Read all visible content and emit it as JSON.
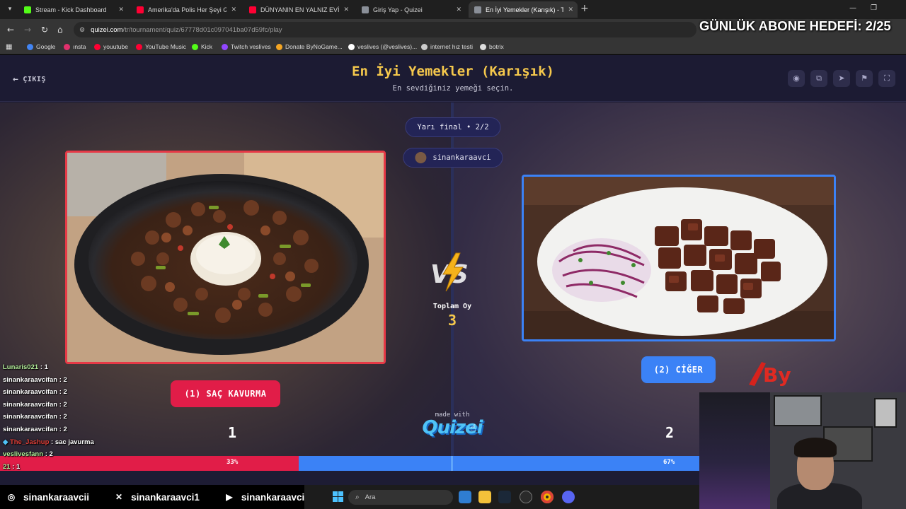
{
  "browser": {
    "tabs": [
      {
        "title": "Stream - Kick Dashboard",
        "color": "#53fc18"
      },
      {
        "title": "Amerika'da Polis Her Şeyi Görüy",
        "color": "#ff0033"
      },
      {
        "title": "DÜNYANIN EN YALNIZ EVİNDE",
        "color": "#ff0033"
      },
      {
        "title": "Giriş Yap - Quizei",
        "color": "#8a8f98"
      },
      {
        "title": "En İyi Yemekler (Karışık) - Tier L",
        "color": "#8a8f98"
      }
    ],
    "url_host": "quizei.com",
    "url_path": "/tr/tournament/quiz/67778d01c097041ba07d59fc/play",
    "bookmarks": [
      {
        "label": "Google",
        "color": "#4285f4"
      },
      {
        "label": "ınsta",
        "color": "#e1306c"
      },
      {
        "label": "youutube",
        "color": "#ff0033"
      },
      {
        "label": "YouTube Music",
        "color": "#ff0033"
      },
      {
        "label": "Kick",
        "color": "#53fc18"
      },
      {
        "label": "Twitch veslives",
        "color": "#9146ff"
      },
      {
        "label": "Donate ByNoGame...",
        "color": "#f5a623"
      },
      {
        "label": "veslives (@veslives)...",
        "color": "#ffffff"
      },
      {
        "label": "internet hız testi",
        "color": "#cccccc"
      },
      {
        "label": "botrix",
        "color": "#dddddd"
      }
    ]
  },
  "stream_overlay": {
    "goal_text": "GÜNLÜK ABONE HEDEFİ: 2/25"
  },
  "quiz": {
    "exit_label": "ÇIKIŞ",
    "title": "En İyi Yemekler (Karışık)",
    "subtitle": "En sevdiğiniz yemeği seçin.",
    "round_label": "Yarı final • 2/2",
    "creator": "sinankaraavci",
    "total_label": "Toplam Oy",
    "total_votes": "3",
    "made_with": "made with",
    "brand": "Quizei",
    "left": {
      "label": "(1) SAÇ KAVURMA",
      "count": "1",
      "percent_label": "33%",
      "share": 0.33
    },
    "right": {
      "label": "(2) CİĞER",
      "count": "2",
      "percent_label": "67%",
      "share": 0.67
    },
    "accent_left": "#e11d48",
    "accent_right": "#3b82f6",
    "title_color": "#f5c84c"
  },
  "chat": [
    {
      "user": "Lunaris021",
      "msg": ": 1"
    },
    {
      "user": "sinankaraavcifan",
      "msg": ": 2"
    },
    {
      "user": "sinankaraavcifan",
      "msg": ": 2"
    },
    {
      "user": "sinankaraavcifan",
      "msg": ": 2"
    },
    {
      "user": "sinankaraavcifan",
      "msg": ": 2"
    },
    {
      "user": "sinankaraavcifan",
      "msg": ": 2"
    },
    {
      "user": "The_Jashup",
      "msg": ": sac javurma"
    },
    {
      "user": "veslivesfann",
      "msg": ": 2"
    },
    {
      "user": "21",
      "msg": ": 1"
    }
  ],
  "socials": [
    {
      "icon": "instagram-icon",
      "handle": "sinankaraavcii"
    },
    {
      "icon": "x-icon",
      "handle": "sinankaraavci1"
    },
    {
      "icon": "youtube-icon",
      "handle": "sinankaraavci"
    }
  ],
  "taskbar": {
    "search_placeholder": "Ara"
  }
}
